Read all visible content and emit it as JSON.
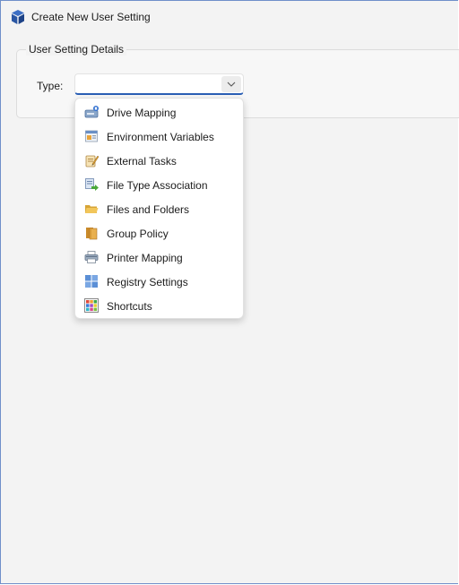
{
  "window": {
    "title": "Create New User Setting"
  },
  "group": {
    "legend": "User Setting Details",
    "type_label": "Type:",
    "type_value": ""
  },
  "dropdown": {
    "items": [
      {
        "label": "Drive Mapping",
        "icon": "drive-icon"
      },
      {
        "label": "Environment Variables",
        "icon": "environment-icon"
      },
      {
        "label": "External Tasks",
        "icon": "tasks-icon"
      },
      {
        "label": "File Type Association",
        "icon": "file-association-icon"
      },
      {
        "label": "Files and Folders",
        "icon": "folder-icon"
      },
      {
        "label": "Group Policy",
        "icon": "group-policy-icon"
      },
      {
        "label": "Printer Mapping",
        "icon": "printer-icon"
      },
      {
        "label": "Registry Settings",
        "icon": "registry-icon"
      },
      {
        "label": "Shortcuts",
        "icon": "shortcuts-icon"
      }
    ]
  },
  "colors": {
    "accent": "#2a5fb5",
    "window_border": "#6f8fc9"
  }
}
